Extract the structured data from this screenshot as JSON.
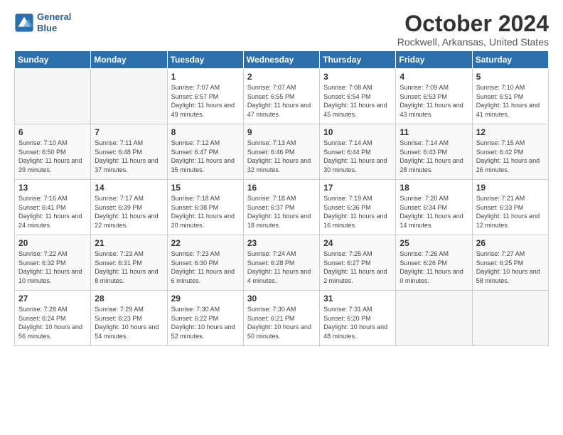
{
  "logo": {
    "line1": "General",
    "line2": "Blue"
  },
  "title": "October 2024",
  "subtitle": "Rockwell, Arkansas, United States",
  "headers": [
    "Sunday",
    "Monday",
    "Tuesday",
    "Wednesday",
    "Thursday",
    "Friday",
    "Saturday"
  ],
  "weeks": [
    [
      {
        "day": "",
        "info": ""
      },
      {
        "day": "",
        "info": ""
      },
      {
        "day": "1",
        "info": "Sunrise: 7:07 AM\nSunset: 6:57 PM\nDaylight: 11 hours and 49 minutes."
      },
      {
        "day": "2",
        "info": "Sunrise: 7:07 AM\nSunset: 6:55 PM\nDaylight: 11 hours and 47 minutes."
      },
      {
        "day": "3",
        "info": "Sunrise: 7:08 AM\nSunset: 6:54 PM\nDaylight: 11 hours and 45 minutes."
      },
      {
        "day": "4",
        "info": "Sunrise: 7:09 AM\nSunset: 6:53 PM\nDaylight: 11 hours and 43 minutes."
      },
      {
        "day": "5",
        "info": "Sunrise: 7:10 AM\nSunset: 6:51 PM\nDaylight: 11 hours and 41 minutes."
      }
    ],
    [
      {
        "day": "6",
        "info": "Sunrise: 7:10 AM\nSunset: 6:50 PM\nDaylight: 11 hours and 39 minutes."
      },
      {
        "day": "7",
        "info": "Sunrise: 7:11 AM\nSunset: 6:48 PM\nDaylight: 11 hours and 37 minutes."
      },
      {
        "day": "8",
        "info": "Sunrise: 7:12 AM\nSunset: 6:47 PM\nDaylight: 11 hours and 35 minutes."
      },
      {
        "day": "9",
        "info": "Sunrise: 7:13 AM\nSunset: 6:46 PM\nDaylight: 11 hours and 32 minutes."
      },
      {
        "day": "10",
        "info": "Sunrise: 7:14 AM\nSunset: 6:44 PM\nDaylight: 11 hours and 30 minutes."
      },
      {
        "day": "11",
        "info": "Sunrise: 7:14 AM\nSunset: 6:43 PM\nDaylight: 11 hours and 28 minutes."
      },
      {
        "day": "12",
        "info": "Sunrise: 7:15 AM\nSunset: 6:42 PM\nDaylight: 11 hours and 26 minutes."
      }
    ],
    [
      {
        "day": "13",
        "info": "Sunrise: 7:16 AM\nSunset: 6:41 PM\nDaylight: 11 hours and 24 minutes."
      },
      {
        "day": "14",
        "info": "Sunrise: 7:17 AM\nSunset: 6:39 PM\nDaylight: 11 hours and 22 minutes."
      },
      {
        "day": "15",
        "info": "Sunrise: 7:18 AM\nSunset: 6:38 PM\nDaylight: 11 hours and 20 minutes."
      },
      {
        "day": "16",
        "info": "Sunrise: 7:18 AM\nSunset: 6:37 PM\nDaylight: 11 hours and 18 minutes."
      },
      {
        "day": "17",
        "info": "Sunrise: 7:19 AM\nSunset: 6:36 PM\nDaylight: 11 hours and 16 minutes."
      },
      {
        "day": "18",
        "info": "Sunrise: 7:20 AM\nSunset: 6:34 PM\nDaylight: 11 hours and 14 minutes."
      },
      {
        "day": "19",
        "info": "Sunrise: 7:21 AM\nSunset: 6:33 PM\nDaylight: 11 hours and 12 minutes."
      }
    ],
    [
      {
        "day": "20",
        "info": "Sunrise: 7:22 AM\nSunset: 6:32 PM\nDaylight: 11 hours and 10 minutes."
      },
      {
        "day": "21",
        "info": "Sunrise: 7:23 AM\nSunset: 6:31 PM\nDaylight: 11 hours and 8 minutes."
      },
      {
        "day": "22",
        "info": "Sunrise: 7:23 AM\nSunset: 6:30 PM\nDaylight: 11 hours and 6 minutes."
      },
      {
        "day": "23",
        "info": "Sunrise: 7:24 AM\nSunset: 6:28 PM\nDaylight: 11 hours and 4 minutes."
      },
      {
        "day": "24",
        "info": "Sunrise: 7:25 AM\nSunset: 6:27 PM\nDaylight: 11 hours and 2 minutes."
      },
      {
        "day": "25",
        "info": "Sunrise: 7:26 AM\nSunset: 6:26 PM\nDaylight: 11 hours and 0 minutes."
      },
      {
        "day": "26",
        "info": "Sunrise: 7:27 AM\nSunset: 6:25 PM\nDaylight: 10 hours and 58 minutes."
      }
    ],
    [
      {
        "day": "27",
        "info": "Sunrise: 7:28 AM\nSunset: 6:24 PM\nDaylight: 10 hours and 56 minutes."
      },
      {
        "day": "28",
        "info": "Sunrise: 7:29 AM\nSunset: 6:23 PM\nDaylight: 10 hours and 54 minutes."
      },
      {
        "day": "29",
        "info": "Sunrise: 7:30 AM\nSunset: 6:22 PM\nDaylight: 10 hours and 52 minutes."
      },
      {
        "day": "30",
        "info": "Sunrise: 7:30 AM\nSunset: 6:21 PM\nDaylight: 10 hours and 50 minutes."
      },
      {
        "day": "31",
        "info": "Sunrise: 7:31 AM\nSunset: 6:20 PM\nDaylight: 10 hours and 48 minutes."
      },
      {
        "day": "",
        "info": ""
      },
      {
        "day": "",
        "info": ""
      }
    ]
  ]
}
